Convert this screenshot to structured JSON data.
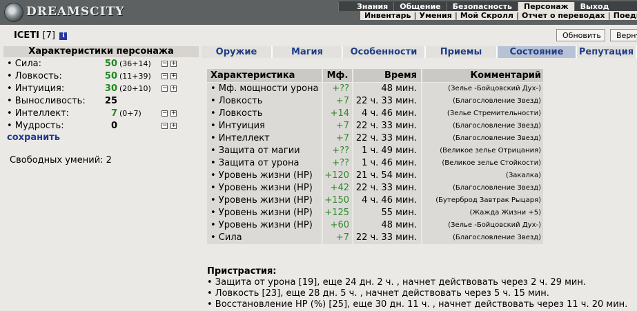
{
  "app": {
    "logo_text": "DREAMSCITY",
    "menu_top": [
      "Знания",
      "Общение",
      "Безопасность",
      "Персонаж",
      "Выход"
    ],
    "menu_top_active": 3,
    "menu_sub": [
      "Инвентарь",
      "Умения",
      "Мой Скролл",
      "Отчет о переводах",
      "Поединки"
    ]
  },
  "header": {
    "char_name": "ICETI",
    "char_level": "[7]",
    "info_icon_glyph": "i",
    "refresh_label": "Обновить",
    "return_label": "Вернуться"
  },
  "stats": {
    "title": "Характеристики персонажа",
    "rows": [
      {
        "label": "• Сила:",
        "value": "50",
        "breakdown": "(36+14)",
        "green": true
      },
      {
        "label": "• Ловкость:",
        "value": "50",
        "breakdown": "(11+39)",
        "green": true
      },
      {
        "label": "• Интуиция:",
        "value": "30",
        "breakdown": "(20+10)",
        "green": true
      },
      {
        "label": "• Выносливость:",
        "value": "25",
        "breakdown": "",
        "green": false
      },
      {
        "label": "• Интеллект:",
        "value": "7",
        "breakdown": "(0+7)",
        "green": true
      },
      {
        "label": "• Мудрость:",
        "value": "0",
        "breakdown": "",
        "green": false
      }
    ],
    "save_label": "сохранить",
    "free_skills": "Свободных умений: 2"
  },
  "tabs": [
    "Оружие",
    "Магия",
    "Особенности",
    "Приемы",
    "Состояние",
    "Репутация"
  ],
  "active_tab": 4,
  "effects": {
    "headers": [
      "Характеристика",
      "Мф.",
      "Время",
      "Комментарий"
    ],
    "rows": [
      [
        "• Мф. мощности урона",
        "+??",
        "48 мин.",
        "(Зелье -Бойцовский Дух-)"
      ],
      [
        "• Ловкость",
        "+7",
        "22 ч. 33 мин.",
        "(Благословление Звезд)"
      ],
      [
        "• Ловкость",
        "+14",
        "4 ч. 46 мин.",
        "(Зелье Стремительности)"
      ],
      [
        "• Интуиция",
        "+7",
        "22 ч. 33 мин.",
        "(Благословление Звезд)"
      ],
      [
        "• Интеллект",
        "+7",
        "22 ч. 33 мин.",
        "(Благословление Звезд)"
      ],
      [
        "• Защита от магии",
        "+??",
        "1 ч. 49 мин.",
        "(Великое зелье Отрицания)"
      ],
      [
        "• Защита от урона",
        "+??",
        "1 ч. 46 мин.",
        "(Великое зелье Стойкости)"
      ],
      [
        "• Уровень жизни (HP)",
        "+120",
        "21 ч. 54 мин.",
        "(Закалка)"
      ],
      [
        "• Уровень жизни (HP)",
        "+42",
        "22 ч. 33 мин.",
        "(Благословление Звезд)"
      ],
      [
        "• Уровень жизни (HP)",
        "+150",
        "4 ч. 46 мин.",
        "(Бутерброд Завтрак Рыцаря)"
      ],
      [
        "• Уровень жизни (HP)",
        "+125",
        "55 мин.",
        "(Жажда Жизни +5)"
      ],
      [
        "• Уровень жизни (HP)",
        "+60",
        "48 мин.",
        "(Зелье -Бойцовский Дух-)"
      ],
      [
        "• Сила",
        "+7",
        "22 ч. 33 мин.",
        "(Благословление Звезд)"
      ]
    ]
  },
  "addictions": {
    "title": "Пристрастия:",
    "rows": [
      "• Защита от урона [19], еще 24 дн. 2 ч. , начнет действовать через 2 ч. 29 мин.",
      "• Ловкость [23], еще 28 дн. 5 ч. , начнет действовать через 5 ч. 15 мин.",
      "• Восстановление HP (%) [25], еще 30 дн. 11 ч. , начнет действовать через 11 ч. 20 мин."
    ]
  },
  "colors": {
    "topbar": "#5e6162",
    "link_blue": "#1d3b8f",
    "green_value": "#1f8a1f",
    "active_tab": "#b8c2d6"
  }
}
